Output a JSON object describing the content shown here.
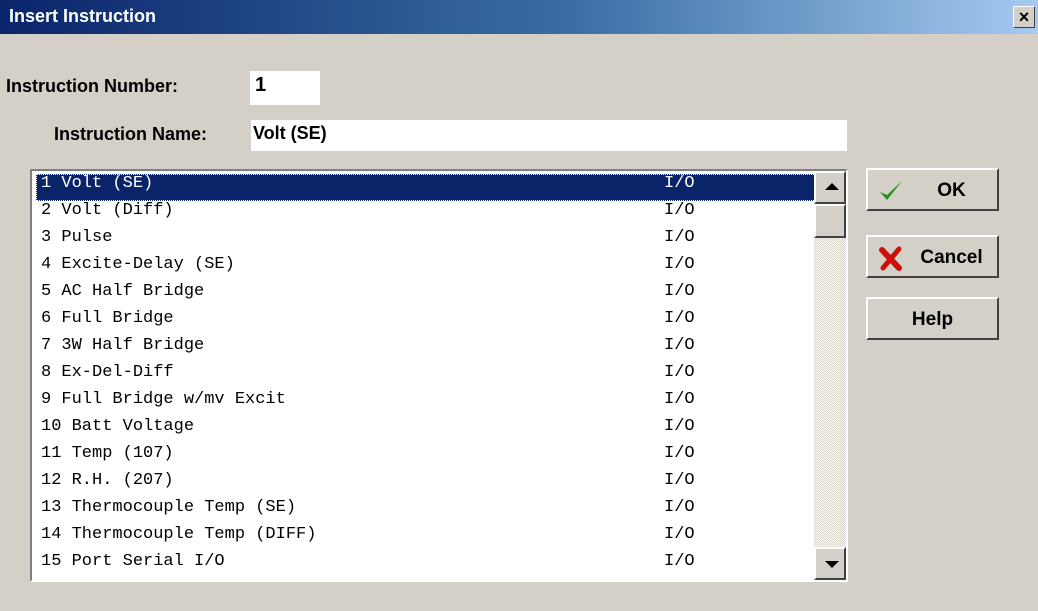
{
  "window": {
    "title": "Insert Instruction",
    "close_label": "×"
  },
  "form": {
    "instruction_number_label": "Instruction Number:",
    "instruction_number_value": "1",
    "instruction_name_label": "Instruction Name:",
    "instruction_name_value": "Volt (SE)"
  },
  "list": {
    "selected_index": 0,
    "items": [
      {
        "name": "1 Volt (SE)",
        "category": "I/O"
      },
      {
        "name": "2 Volt (Diff)",
        "category": "I/O"
      },
      {
        "name": "3 Pulse",
        "category": "I/O"
      },
      {
        "name": "4 Excite-Delay (SE)",
        "category": "I/O"
      },
      {
        "name": "5 AC Half Bridge",
        "category": "I/O"
      },
      {
        "name": "6 Full Bridge",
        "category": "I/O"
      },
      {
        "name": "7 3W Half Bridge",
        "category": "I/O"
      },
      {
        "name": "8 Ex-Del-Diff",
        "category": "I/O"
      },
      {
        "name": "9 Full Bridge w/mv Excit",
        "category": "I/O"
      },
      {
        "name": "10 Batt Voltage",
        "category": "I/O"
      },
      {
        "name": "11 Temp (107)",
        "category": "I/O"
      },
      {
        "name": "12 R.H. (207)",
        "category": "I/O"
      },
      {
        "name": "13 Thermocouple Temp (SE)",
        "category": "I/O"
      },
      {
        "name": "14 Thermocouple Temp (DIFF)",
        "category": "I/O"
      },
      {
        "name": "15 Port Serial I/O",
        "category": "I/O"
      }
    ]
  },
  "buttons": {
    "ok": {
      "label": "OK",
      "icon": "checkmark-icon",
      "color": "#2e8b20"
    },
    "cancel": {
      "label": "Cancel",
      "icon": "x-icon",
      "color": "#cc1010"
    },
    "help": {
      "label": "Help"
    }
  }
}
